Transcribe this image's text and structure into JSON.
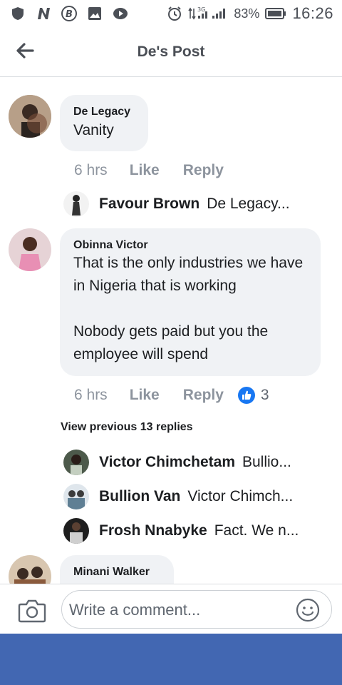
{
  "status_bar": {
    "battery": "83%",
    "network": "3G",
    "time": "16:26"
  },
  "header": {
    "title": "De's Post"
  },
  "comments": [
    {
      "author": "De Legacy",
      "text": "Vanity",
      "time": "6 hrs",
      "like_label": "Like",
      "reply_label": "Reply",
      "replies": [
        {
          "author": "Favour Brown",
          "text": "De Legacy..."
        }
      ]
    },
    {
      "author": "Obinna Victor",
      "text": "That is the only industries we have in Nigeria that is working\n\nNobody gets paid but you the employee will spend",
      "time": "6 hrs",
      "like_label": "Like",
      "reply_label": "Reply",
      "reaction_count": "3",
      "view_previous": "View previous 13 replies",
      "replies": [
        {
          "author": "Victor Chimchetam",
          "text": "Bullio..."
        },
        {
          "author": "Bullion Van",
          "text": "Victor Chimch..."
        },
        {
          "author": "Frosh Nnabyke",
          "text": "Fact. We n..."
        }
      ]
    },
    {
      "author": "Minani Walker"
    }
  ],
  "composer": {
    "placeholder": "Write a comment..."
  },
  "colors": {
    "brand": "#4267b2",
    "bubble": "#f0f2f5",
    "like_blue": "#1877f2"
  },
  "icons": [
    "shield-icon",
    "n-app-icon",
    "bitcoin-icon",
    "image-icon",
    "video-icon",
    "alarm-icon",
    "signal-icon",
    "battery-icon",
    "back-arrow-icon",
    "like-reaction-icon",
    "camera-icon",
    "emoji-icon"
  ]
}
